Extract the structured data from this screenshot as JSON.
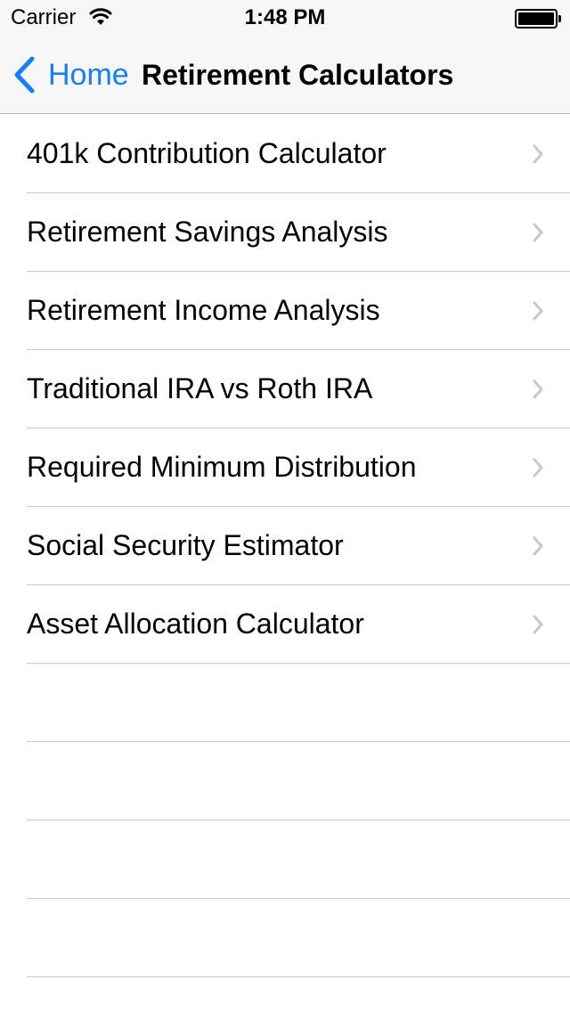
{
  "status_bar": {
    "carrier": "Carrier",
    "time": "1:48 PM",
    "wifi_icon": "wifi-icon",
    "battery_icon": "battery-icon"
  },
  "nav": {
    "back_label": "Home",
    "back_icon": "chevron-left-icon",
    "title": "Retirement Calculators"
  },
  "colors": {
    "accent": "#157efb",
    "separator": "#c8c7cc",
    "chevron": "#c7c7cc",
    "bar_background": "#f7f7f7"
  },
  "list": {
    "items": [
      {
        "label": "401k Contribution Calculator"
      },
      {
        "label": "Retirement Savings Analysis"
      },
      {
        "label": "Retirement Income Analysis"
      },
      {
        "label": "Traditional IRA vs Roth IRA"
      },
      {
        "label": "Required Minimum Distribution"
      },
      {
        "label": "Social Security Estimator"
      },
      {
        "label": "Asset Allocation Calculator"
      }
    ],
    "disclosure_icon": "chevron-right-icon"
  }
}
